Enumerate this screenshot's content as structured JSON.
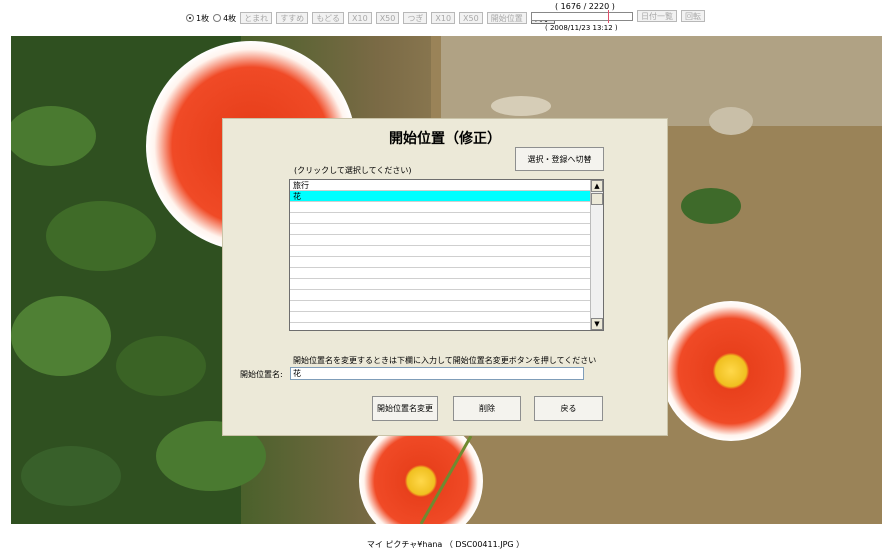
{
  "toolbar": {
    "radio_single": "1枚",
    "radio_quad": "4枚",
    "btn_pause": "とまれ",
    "btn_forward": "すすめ",
    "btn_back": "もどる",
    "btn_x10_back": "X10",
    "btn_x50_back": "X50",
    "btn_next": "つぎ",
    "btn_x10_next": "X10",
    "btn_x50_next": "X50",
    "btn_start_position": "開始位置",
    "btn_exit": "終了",
    "counter": "( 1676 / 2220 )",
    "datetime": "( 2008/11/23 13:12 )",
    "progress": 0.755,
    "btn_date_list": "日付一覧",
    "btn_rotate": "回転"
  },
  "dialog": {
    "title": "開始位置（修正）",
    "switch_button": "選択・登録へ切替",
    "list_hint": "(クリックして選択してください)",
    "list_items": [
      "旅行",
      "花"
    ],
    "selected_index": 1,
    "rename_hint": "開始位置名を変更するときは下欄に入力して開始位置名変更ボタンを押してください",
    "name_label": "開始位置名:",
    "name_value": "花",
    "btn_rename": "開始位置名変更",
    "btn_delete": "削除",
    "btn_return": "戻る"
  },
  "caption": "マイ ピクチャ¥hana （ DSC00411.JPG ）",
  "colors": {
    "selection": "#00ffff",
    "dialog_bg": "#ece9d8",
    "slider_marker": "#e0506a"
  }
}
